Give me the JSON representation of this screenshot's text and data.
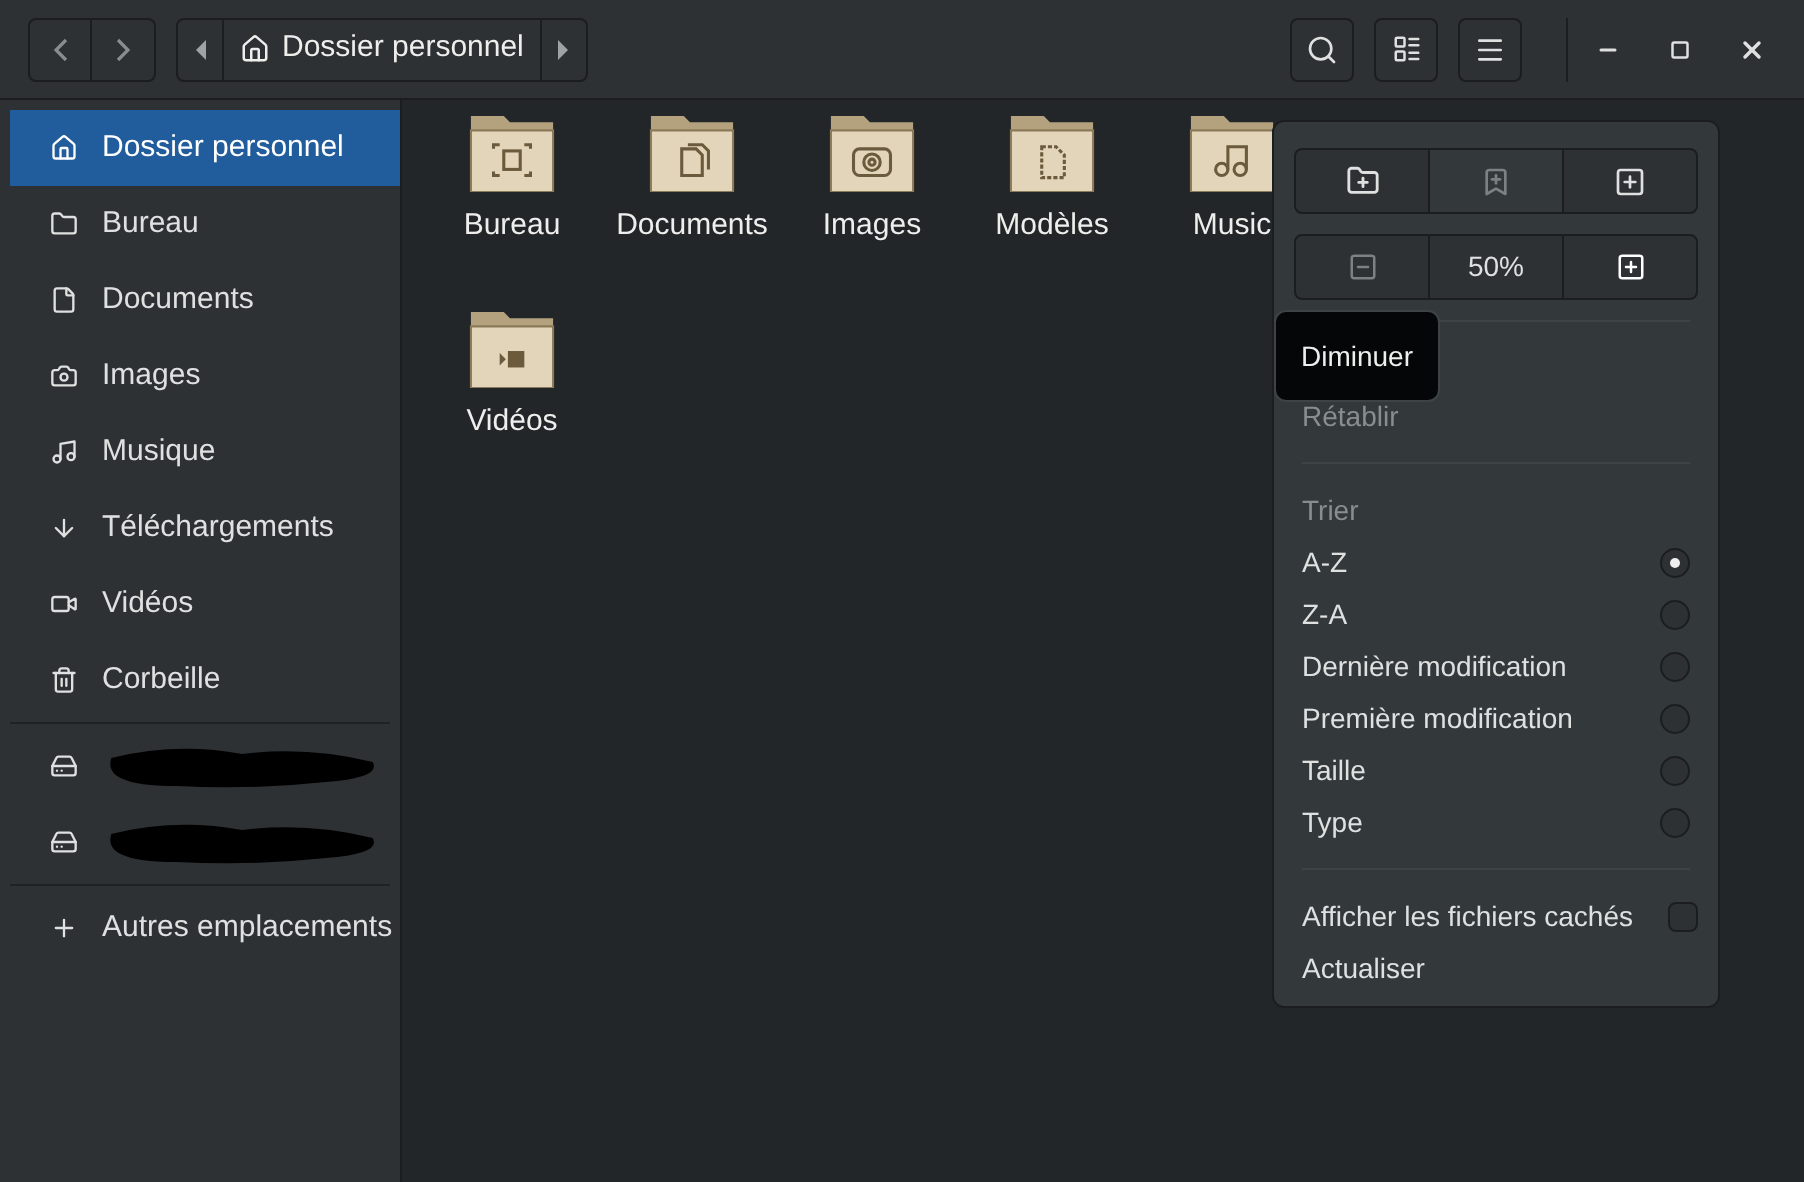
{
  "header": {
    "path": [
      {
        "label": "Dossier personnel",
        "selected": true
      }
    ]
  },
  "sidebar": {
    "items": [
      {
        "label": "Dossier personnel",
        "kind": "home",
        "selected": true
      },
      {
        "label": "Bureau",
        "kind": "desktop",
        "selected": false
      },
      {
        "label": "Documents",
        "kind": "document",
        "selected": false
      },
      {
        "label": "Images",
        "kind": "camera",
        "selected": false
      },
      {
        "label": "Musique",
        "kind": "music",
        "selected": false
      },
      {
        "label": "Téléchargements",
        "kind": "download",
        "selected": false
      },
      {
        "label": "Vidéos",
        "kind": "video",
        "selected": false
      },
      {
        "label": "Corbeille",
        "kind": "trash",
        "selected": false
      }
    ],
    "network": [
      {
        "kind": "server"
      },
      {
        "kind": "server"
      }
    ],
    "other": {
      "label": "Autres emplacements"
    }
  },
  "files": [
    {
      "name": "Bureau",
      "kind": "desktop"
    },
    {
      "name": "Documents",
      "kind": "document"
    },
    {
      "name": "Images",
      "kind": "camera"
    },
    {
      "name": "Modèles",
      "kind": "template"
    },
    {
      "name": "Music",
      "kind": "music"
    },
    {
      "name": "Vidéos",
      "kind": "video"
    }
  ],
  "menu": {
    "zoom": "50%",
    "zoom_out_disabled": true,
    "tooltip": "Diminuer",
    "redo": {
      "label": "Rétablir",
      "disabled": true
    },
    "sort_heading": "Trier",
    "sort": [
      {
        "label": "A-Z",
        "selected": true
      },
      {
        "label": "Z-A",
        "selected": false
      },
      {
        "label": "Dernière modification",
        "selected": false
      },
      {
        "label": "Première modification",
        "selected": false
      },
      {
        "label": "Taille",
        "selected": false
      },
      {
        "label": "Type",
        "selected": false
      }
    ],
    "show_hidden": {
      "label": "Afficher les fichiers cachés",
      "checked": false
    },
    "refresh": "Actualiser"
  }
}
